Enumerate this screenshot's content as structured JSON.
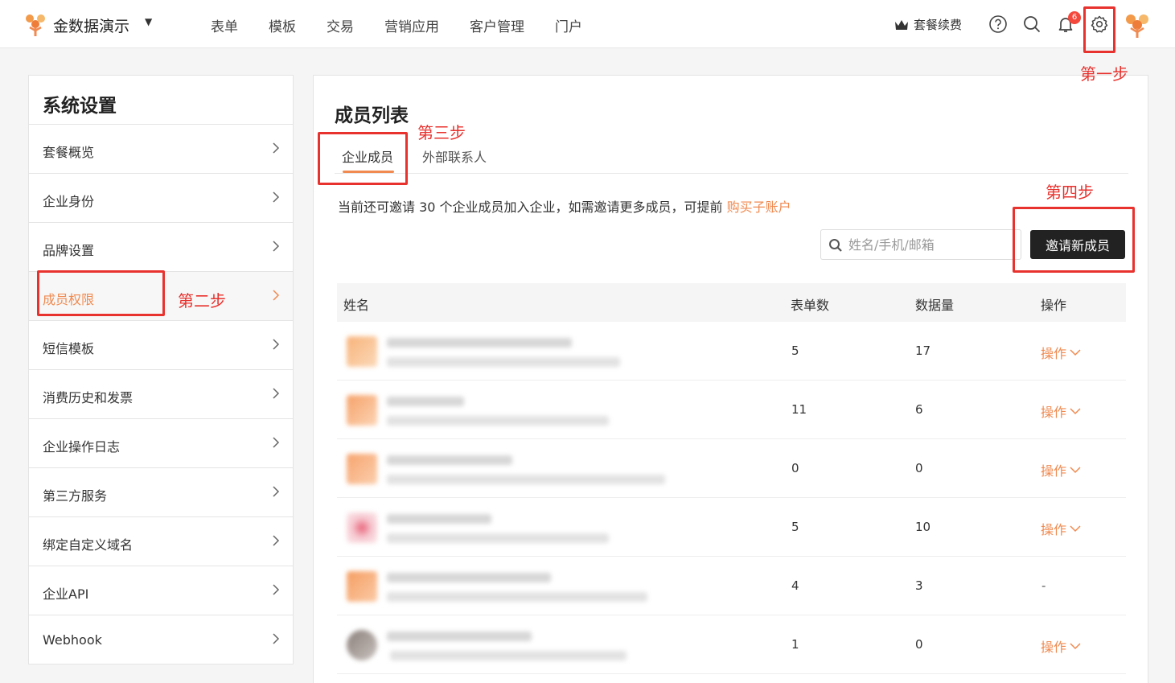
{
  "app": {
    "name": "金数据演示",
    "brand_color": "#f08a50"
  },
  "nav": [
    "表单",
    "模板",
    "交易",
    "营销应用",
    "客户管理",
    "门户"
  ],
  "topbar": {
    "renew_label": "套餐续费",
    "notification_count": "6"
  },
  "annotations": {
    "step1": "第一步",
    "step2": "第二步",
    "step3": "第三步",
    "step4": "第四步",
    "color": "#e8322e"
  },
  "sidebar": {
    "title": "系统设置",
    "items": [
      {
        "label": "套餐概览"
      },
      {
        "label": "企业身份"
      },
      {
        "label": "品牌设置"
      },
      {
        "label": "成员权限",
        "active": true
      },
      {
        "label": "短信模板"
      },
      {
        "label": "消费历史和发票"
      },
      {
        "label": "企业操作日志"
      },
      {
        "label": "第三方服务"
      },
      {
        "label": "绑定自定义域名"
      },
      {
        "label": "企业API"
      },
      {
        "label": "Webhook"
      }
    ]
  },
  "main": {
    "title": "成员列表",
    "tabs": [
      "企业成员",
      "外部联系人"
    ],
    "notice_text": "当前还可邀请 30 个企业成员加入企业，如需邀请更多成员，可提前 ",
    "notice_link": "购买子账户",
    "search_placeholder": "姓名/手机/邮箱",
    "invite_label": "邀请新成员",
    "columns": [
      "姓名",
      "表单数",
      "数据量",
      "操作"
    ],
    "rows": [
      {
        "forms": "5",
        "records": "17",
        "action": "操作"
      },
      {
        "forms": "11",
        "records": "6",
        "action": "操作"
      },
      {
        "forms": "0",
        "records": "0",
        "action": "操作"
      },
      {
        "forms": "5",
        "records": "10",
        "action": "操作"
      },
      {
        "forms": "4",
        "records": "3",
        "action": "-"
      },
      {
        "forms": "1",
        "records": "0",
        "action": "操作"
      }
    ]
  }
}
